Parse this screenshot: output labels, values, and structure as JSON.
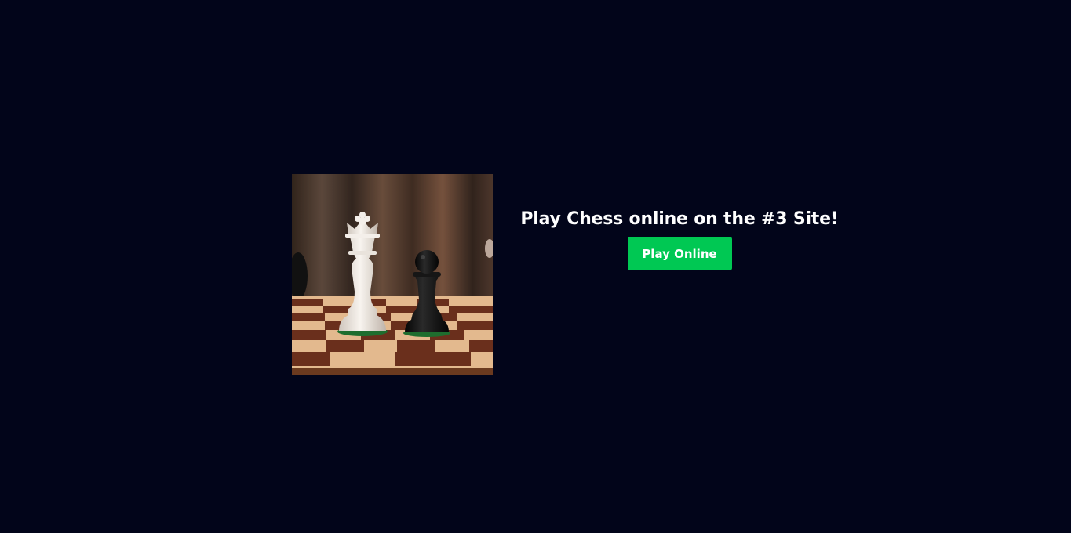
{
  "hero": {
    "image_alt": "white king and black pawn on a chessboard"
  },
  "cta": {
    "headline": "Play Chess online on the #3 Site!",
    "button_label": "Play Online",
    "button_color": "#00c853"
  },
  "colors": {
    "page_background": "#02051a",
    "headline_text": "#ffffff"
  }
}
